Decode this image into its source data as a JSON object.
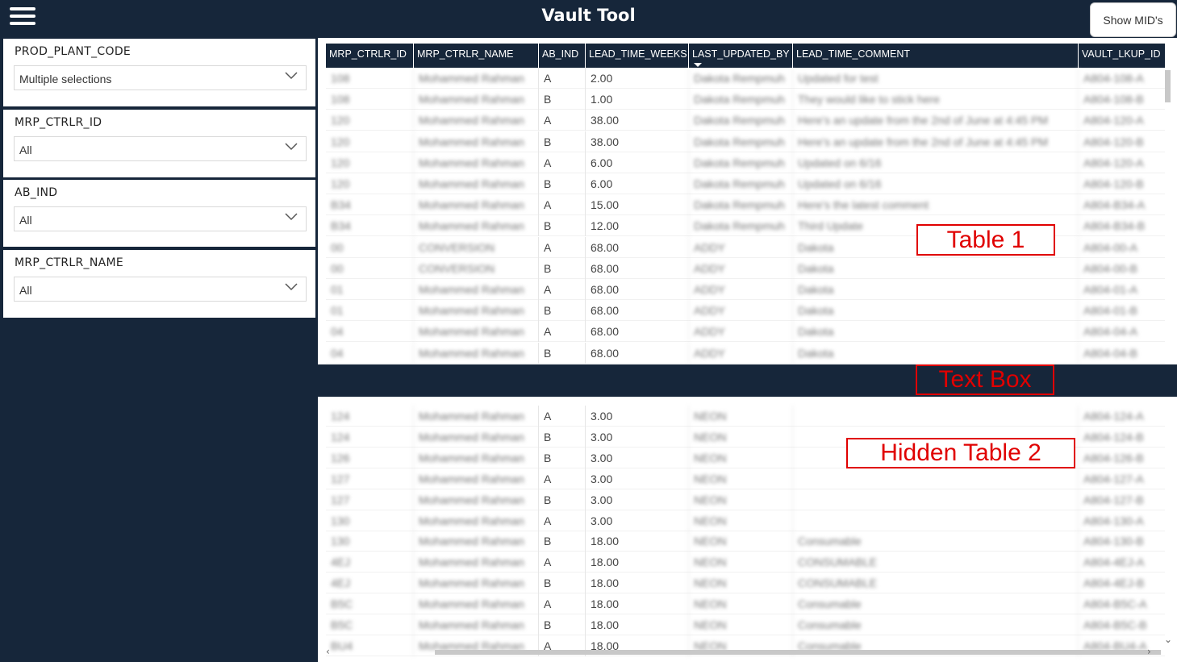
{
  "header": {
    "title": "Vault Tool",
    "show_button_label": "Show MID's"
  },
  "slicers": [
    {
      "title": "PROD_PLANT_CODE",
      "value": "Multiple selections"
    },
    {
      "title": "MRP_CTRLR_ID",
      "value": "All"
    },
    {
      "title": "AB_IND",
      "value": "All"
    },
    {
      "title": "MRP_CTRLR_NAME",
      "value": "All"
    }
  ],
  "table": {
    "columns": [
      "MRP_CTRLR_ID",
      "MRP_CTRLR_NAME",
      "AB_IND",
      "LEAD_TIME_WEEKS",
      "LAST_UPDATED_BY",
      "LEAD_TIME_COMMENT",
      "VAULT_LKUP_ID"
    ],
    "rows1": [
      [
        "108",
        "Mohammed Rahman",
        "A",
        "2.00",
        "Dakota Rempmuh",
        "Updated for test",
        "A804-108-A"
      ],
      [
        "108",
        "Mohammed Rahman",
        "B",
        "1.00",
        "Dakota Rempmuh",
        "They would like to stick here",
        "A804-108-B"
      ],
      [
        "120",
        "Mohammed Rahman",
        "A",
        "38.00",
        "Dakota Rempmuh",
        "Here's an update from the 2nd of June at 4:45 PM",
        "A804-120-A"
      ],
      [
        "120",
        "Mohammed Rahman",
        "B",
        "38.00",
        "Dakota Rempmuh",
        "Here's an update from the 2nd of June at 4:45 PM",
        "A804-120-B"
      ],
      [
        "120",
        "Mohammed Rahman",
        "A",
        "6.00",
        "Dakota Rempmuh",
        "Updated on 6/16",
        "A804-120-A"
      ],
      [
        "120",
        "Mohammed Rahman",
        "B",
        "6.00",
        "Dakota Rempmuh",
        "Updated on 6/16",
        "A804-120-B"
      ],
      [
        "B34",
        "Mohammed Rahman",
        "A",
        "15.00",
        "Dakota Rempmuh",
        "Here's the latest comment",
        "A804-B34-A"
      ],
      [
        "B34",
        "Mohammed Rahman",
        "B",
        "12.00",
        "Dakota Rempmuh",
        "Third Update",
        "A804-B34-B"
      ],
      [
        "00",
        "CONVERSION",
        "A",
        "68.00",
        "ADDY",
        "Dakota",
        "A804-00-A"
      ],
      [
        "00",
        "CONVERSION",
        "B",
        "68.00",
        "ADDY",
        "Dakota",
        "A804-00-B"
      ],
      [
        "01",
        "Mohammed Rahman",
        "A",
        "68.00",
        "ADDY",
        "Dakota",
        "A804-01-A"
      ],
      [
        "01",
        "Mohammed Rahman",
        "B",
        "68.00",
        "ADDY",
        "Dakota",
        "A804-01-B"
      ],
      [
        "04",
        "Mohammed Rahman",
        "A",
        "68.00",
        "ADDY",
        "Dakota",
        "A804-04-A"
      ],
      [
        "04",
        "Mohammed Rahman",
        "B",
        "68.00",
        "ADDY",
        "Dakota",
        "A804-04-B"
      ]
    ],
    "rows2": [
      [
        "124",
        "Mohammed Rahman",
        "A",
        "3.00",
        "NEON",
        "",
        "A804-124-A"
      ],
      [
        "124",
        "Mohammed Rahman",
        "B",
        "3.00",
        "NEON",
        "",
        "A804-124-B"
      ],
      [
        "126",
        "Mohammed Rahman",
        "B",
        "3.00",
        "NEON",
        "",
        "A804-126-B"
      ],
      [
        "127",
        "Mohammed Rahman",
        "A",
        "3.00",
        "NEON",
        "",
        "A804-127-A"
      ],
      [
        "127",
        "Mohammed Rahman",
        "B",
        "3.00",
        "NEON",
        "",
        "A804-127-B"
      ],
      [
        "130",
        "Mohammed Rahman",
        "A",
        "3.00",
        "NEON",
        "",
        "A804-130-A"
      ],
      [
        "130",
        "Mohammed Rahman",
        "B",
        "18.00",
        "NEON",
        "Consumable",
        "A804-130-B"
      ],
      [
        "4EJ",
        "Mohammed Rahman",
        "A",
        "18.00",
        "NEON",
        "CONSUMABLE",
        "A804-4EJ-A"
      ],
      [
        "4EJ",
        "Mohammed Rahman",
        "B",
        "18.00",
        "NEON",
        "CONSUMABLE",
        "A804-4EJ-B"
      ],
      [
        "B5C",
        "Mohammed Rahman",
        "A",
        "18.00",
        "NEON",
        "Consumable",
        "A804-B5C-A"
      ],
      [
        "B5C",
        "Mohammed Rahman",
        "B",
        "18.00",
        "NEON",
        "Consumable",
        "A804-B5C-B"
      ],
      [
        "BU4",
        "Mohammed Rahman",
        "A",
        "18.00",
        "NEON",
        "Consumable",
        "A804-BU4-A"
      ]
    ]
  },
  "annotations": {
    "table1": "Table 1",
    "text_box": "Text Box",
    "hidden_table2": "Hidden Table 2"
  },
  "colors": {
    "navy": "#16263a",
    "annotation_red": "#e00000"
  }
}
